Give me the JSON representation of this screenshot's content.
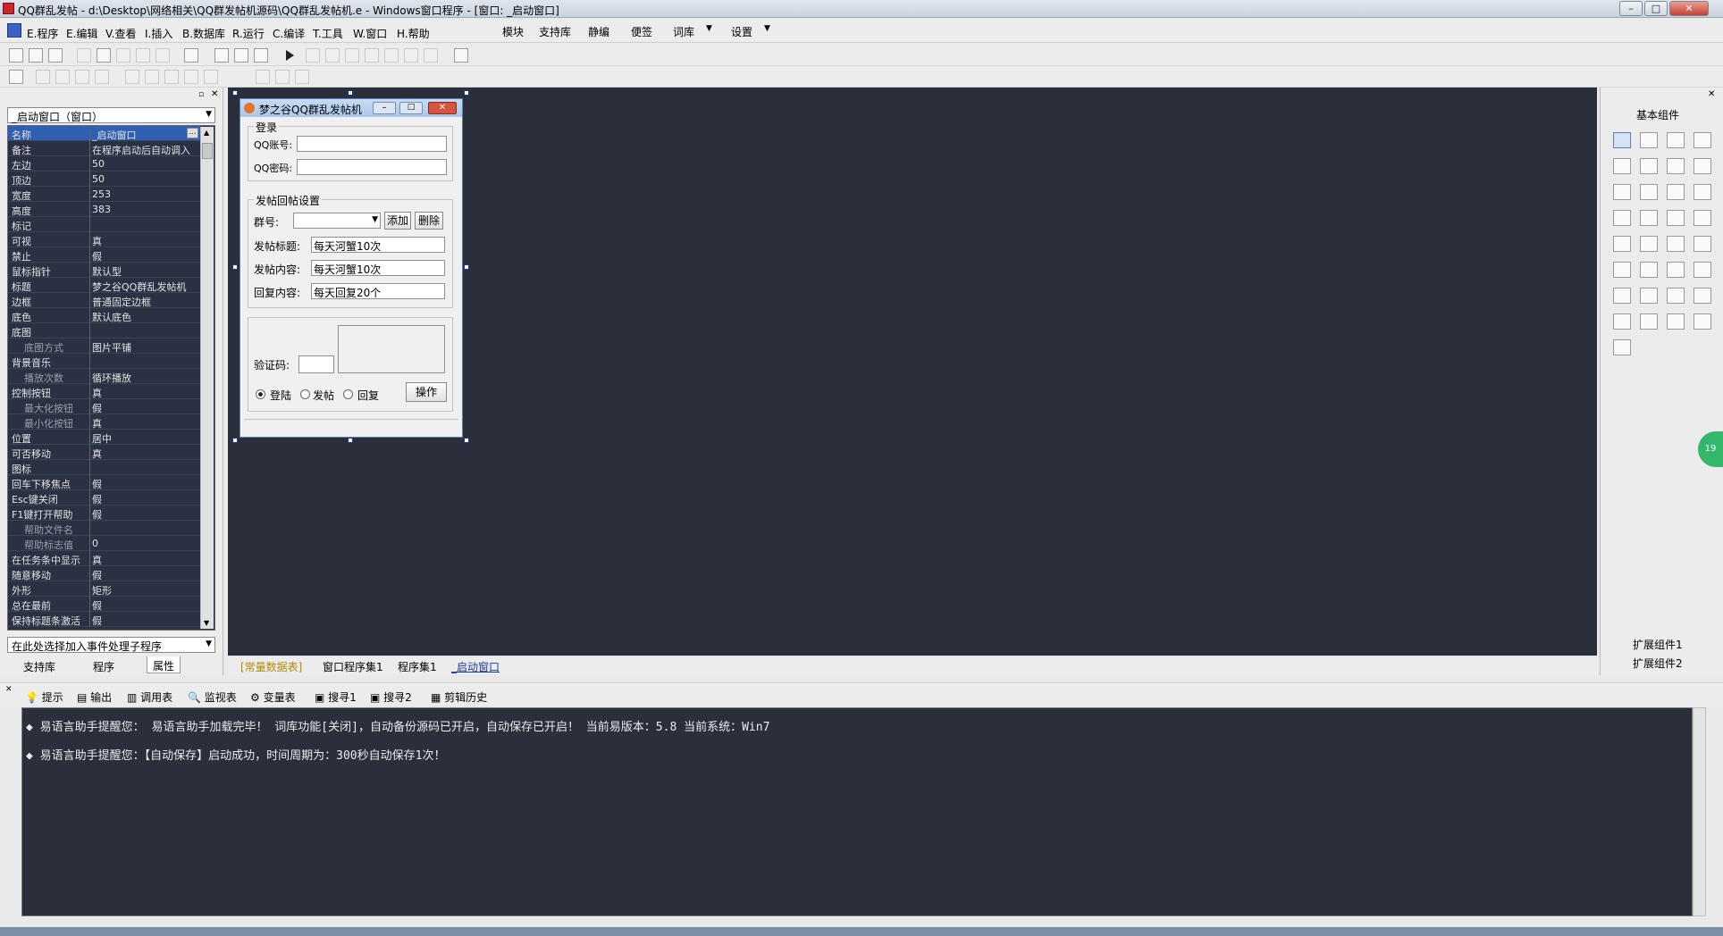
{
  "window": {
    "title": "QQ群乱发帖 - d:\\Desktop\\网络相关\\QQ群发帖机源码\\QQ群乱发帖机.e - Windows窗口程序 - [窗口: _启动窗口]",
    "minimize": "–",
    "maximize": "□",
    "close": "✕"
  },
  "menu": [
    "E.程序",
    "E.编辑",
    "V.查看",
    "I.插入",
    "B.数据库",
    "R.运行",
    "C.编译",
    "T.工具",
    "W.窗口",
    "H.帮助",
    "模块",
    "支持库",
    "静编",
    "便签",
    "词库",
    "▼",
    "设置",
    "▼"
  ],
  "props_panel": {
    "combo": "_启动窗口（窗口）",
    "rows": [
      {
        "k": "名称",
        "v": "_启动窗口",
        "sel": true
      },
      {
        "k": "备注",
        "v": "在程序启动后自动调入"
      },
      {
        "k": "左边",
        "v": "50"
      },
      {
        "k": "顶边",
        "v": "50"
      },
      {
        "k": "宽度",
        "v": "253"
      },
      {
        "k": "高度",
        "v": "383"
      },
      {
        "k": "标记",
        "v": ""
      },
      {
        "k": "可视",
        "v": "真"
      },
      {
        "k": "禁止",
        "v": "假"
      },
      {
        "k": "鼠标指针",
        "v": "默认型"
      },
      {
        "k": "标题",
        "v": "梦之谷QQ群乱发帖机"
      },
      {
        "k": "边框",
        "v": "普通固定边框"
      },
      {
        "k": "底色",
        "v": "默认底色"
      },
      {
        "k": "底图",
        "v": ""
      },
      {
        "k": "底图方式",
        "v": "图片平铺",
        "ind": true
      },
      {
        "k": "背景音乐",
        "v": ""
      },
      {
        "k": "播放次数",
        "v": "循环播放",
        "ind": true
      },
      {
        "k": "控制按钮",
        "v": "真"
      },
      {
        "k": "最大化按钮",
        "v": "假",
        "ind": true
      },
      {
        "k": "最小化按钮",
        "v": "真",
        "ind": true
      },
      {
        "k": "位置",
        "v": "居中"
      },
      {
        "k": "可否移动",
        "v": "真"
      },
      {
        "k": "图标",
        "v": ""
      },
      {
        "k": "回车下移焦点",
        "v": "假"
      },
      {
        "k": "Esc键关闭",
        "v": "假"
      },
      {
        "k": "F1键打开帮助",
        "v": "假"
      },
      {
        "k": "帮助文件名",
        "v": "",
        "ind": true
      },
      {
        "k": "帮助标志值",
        "v": "0",
        "ind": true
      },
      {
        "k": "在任务条中显示",
        "v": "真"
      },
      {
        "k": "随意移动",
        "v": "假"
      },
      {
        "k": "外形",
        "v": "矩形"
      },
      {
        "k": "总在最前",
        "v": "假"
      },
      {
        "k": "保持标题条激活",
        "v": "假"
      }
    ],
    "event_combo": "在此处选择加入事件处理子程序",
    "tabs": [
      "支持库",
      "程序",
      "属性"
    ]
  },
  "form": {
    "caption": "梦之谷QQ群乱发帖机",
    "login_group": "登录",
    "qq_account_label": "QQ账号:",
    "qq_password_label": "QQ密码:",
    "post_group": "发帖回帖设置",
    "group_no_label": "群号:",
    "add_button": "添加",
    "delete_button": "删除",
    "post_title_label": "发帖标题:",
    "post_title_value": "每天河蟹10次",
    "post_content_label": "发帖内容:",
    "post_content_value": "每天河蟹10次",
    "reply_content_label": "回复内容:",
    "reply_content_value": "每天回复20个",
    "captcha_label": "验证码:",
    "radio_login": "登陆",
    "radio_post": "发帖",
    "radio_reply": "回复",
    "operate_button": "操作"
  },
  "editor_tabs": [
    "[常量数据表]",
    "窗口程序集1",
    "程序集1",
    "_启动窗口"
  ],
  "components": {
    "title": "基本组件",
    "ext1": "扩展组件1",
    "ext2": "扩展组件2"
  },
  "bottom_tabs": [
    "提示",
    "输出",
    "调用表",
    "监视表",
    "变量表",
    "搜寻1",
    "搜寻2",
    "剪辑历史"
  ],
  "output_lines": [
    "◆ 易语言助手提醒您： 易语言助手加载完毕！ 词库功能[关闭]，自动备份源码已开启，自动保存已开启！ 当前易版本：5.8  当前系统：Win7",
    "◆ 易语言助手提醒您：【自动保存】启动成功，时间周期为：300秒自动保存1次！"
  ],
  "badge": "19",
  "colors": {
    "designer_bg": "#2a2f3b",
    "selected_row": "#2f5fb3"
  }
}
